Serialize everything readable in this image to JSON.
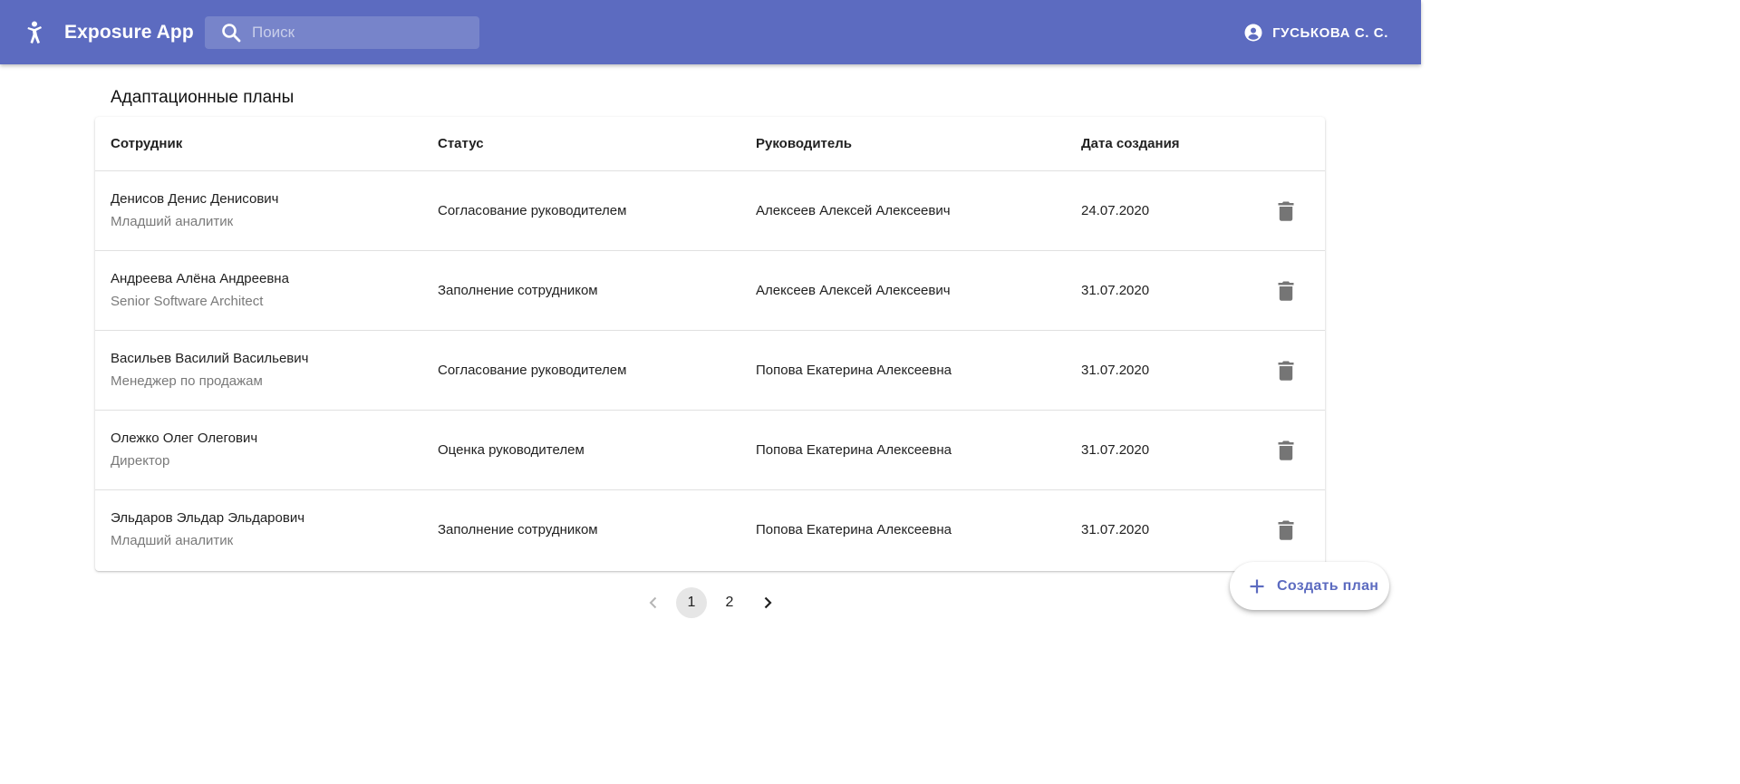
{
  "app": {
    "title": "Exposure App",
    "brand_color": "#5c6bc0"
  },
  "search": {
    "placeholder": "Поиск",
    "value": ""
  },
  "user": {
    "name": "ГУСЬКОВА С. С.",
    "icon": "account-circle-icon"
  },
  "page": {
    "title": "Адаптационные планы"
  },
  "table": {
    "columns": {
      "employee": "Сотрудник",
      "status": "Статус",
      "manager": "Руководитель",
      "created": "Дата создания"
    },
    "rows": [
      {
        "name": "Денисов Денис Денисович",
        "position": "Младший аналитик",
        "status": "Согласование руководителем",
        "manager": "Алексеев Алексей Алексеевич",
        "date": "24.07.2020"
      },
      {
        "name": "Андреева Алёна Андреевна",
        "position": "Senior Software Architect",
        "status": "Заполнение сотрудником",
        "manager": "Алексеев Алексей Алексеевич",
        "date": "31.07.2020"
      },
      {
        "name": "Васильев Василий Васильевич",
        "position": "Менеджер по продажам",
        "status": "Согласование руководителем",
        "manager": "Попова Екатерина Алексеевна",
        "date": "31.07.2020"
      },
      {
        "name": "Олежко Олег Олегович",
        "position": "Директор",
        "status": "Оценка руководителем",
        "manager": "Попова Екатерина Алексеевна",
        "date": "31.07.2020"
      },
      {
        "name": "Эльдаров Эльдар Эльдарович",
        "position": "Младший аналитик",
        "status": "Заполнение сотрудником",
        "manager": "Попова Екатерина Алексеевна",
        "date": "31.07.2020"
      }
    ]
  },
  "pagination": {
    "pages": [
      "1",
      "2"
    ],
    "current": "1"
  },
  "fab": {
    "label": "Создать план",
    "icon": "plus-icon"
  }
}
